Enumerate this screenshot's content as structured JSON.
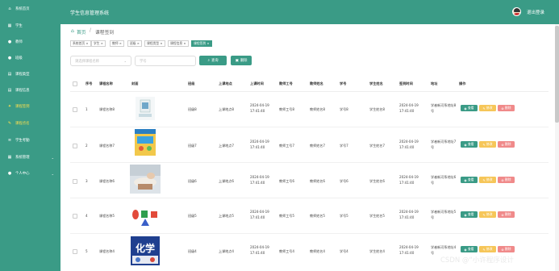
{
  "app": {
    "title": "学生信息管理系统",
    "logout_label": "退出登录"
  },
  "sidebar": {
    "items": [
      {
        "label": "系统首页",
        "icon": "home-icon"
      },
      {
        "label": "学生",
        "icon": "grid-icon"
      },
      {
        "label": "教师",
        "icon": "user-icon"
      },
      {
        "label": "班级",
        "icon": "user-icon"
      },
      {
        "label": "课程类型",
        "icon": "book-icon"
      },
      {
        "label": "课程信息",
        "icon": "book-icon"
      },
      {
        "label": "课程签到",
        "icon": "pin-icon"
      },
      {
        "label": "课程点名",
        "icon": "pencil-icon"
      },
      {
        "label": "学生考勤",
        "icon": "bars-icon"
      },
      {
        "label": "系统管理",
        "icon": "grid-icon"
      },
      {
        "label": "个人中心",
        "icon": "user-icon"
      }
    ]
  },
  "breadcrumb": {
    "home": "首页",
    "sep": "/",
    "current": "课程签到"
  },
  "tabs": [
    "系统首页 ×",
    "学生 ×",
    "教师 ×",
    "班级 ×",
    "课程类型 ×",
    "课程信息 ×",
    "课程签到 ×"
  ],
  "search": {
    "select_placeholder": "请选择课程名称",
    "input_placeholder": "学号",
    "search_label": "查询",
    "delete_label": "删除"
  },
  "table": {
    "headers": [
      "序号",
      "课程名称",
      "封面",
      "班级",
      "上课地点",
      "上课时间",
      "教师工号",
      "教师姓名",
      "学号",
      "学生姓名",
      "签到时间",
      "地址",
      "操作"
    ],
    "rows": [
      {
        "no": "1",
        "course": "课程名称8",
        "class": "班级8",
        "place": "上课地点8",
        "time": "2024-04-19 17:41:40",
        "tid": "教师工号8",
        "tname": "教师姓名8",
        "sid": "学号8",
        "sname": "学生姓名8",
        "checkin": "2024-04-19 17:41:40",
        "addr": "学者新河系地址8号"
      },
      {
        "no": "2",
        "course": "课程名称7",
        "class": "班级7",
        "place": "上课地点7",
        "time": "2024-04-19 17:41:40",
        "tid": "教师工号7",
        "tname": "教师姓名7",
        "sid": "学号7",
        "sname": "学生姓名7",
        "checkin": "2024-04-19 17:41:40",
        "addr": "学者新河系地址7号"
      },
      {
        "no": "3",
        "course": "课程名称6",
        "class": "班级6",
        "place": "上课地点6",
        "time": "2024-04-19 17:41:40",
        "tid": "教师工号6",
        "tname": "教师姓名6",
        "sid": "学号6",
        "sname": "学生姓名6",
        "checkin": "2024-04-19 17:41:40",
        "addr": "学者新河系地址6号"
      },
      {
        "no": "4",
        "course": "课程名称5",
        "class": "班级5",
        "place": "上课地点5",
        "time": "2024-04-19 17:41:40",
        "tid": "教师工号5",
        "tname": "教师姓名5",
        "sid": "学号5",
        "sname": "学生姓名5",
        "checkin": "2024-04-19 17:41:40",
        "addr": "学者新河系地址5号"
      },
      {
        "no": "5",
        "course": "课程名称4",
        "class": "班级4",
        "place": "上课地点4",
        "time": "2024-04-19 17:41:40",
        "tid": "教师工号4",
        "tname": "教师姓名4",
        "sid": "学号4",
        "sname": "学生姓名4",
        "checkin": "2024-04-19 17:41:40",
        "addr": "学者新河系地址4号"
      }
    ]
  },
  "actions": {
    "view": "查看",
    "edit": "修改",
    "delete": "删除"
  },
  "cover_texts": {
    "row5": "化学"
  },
  "watermark": "CSDN @“小许程序设计",
  "colors": {
    "primary": "#3a9b86",
    "edit": "#f6c659",
    "delete": "#f08a8a",
    "active_menu": "#ffe04d"
  }
}
